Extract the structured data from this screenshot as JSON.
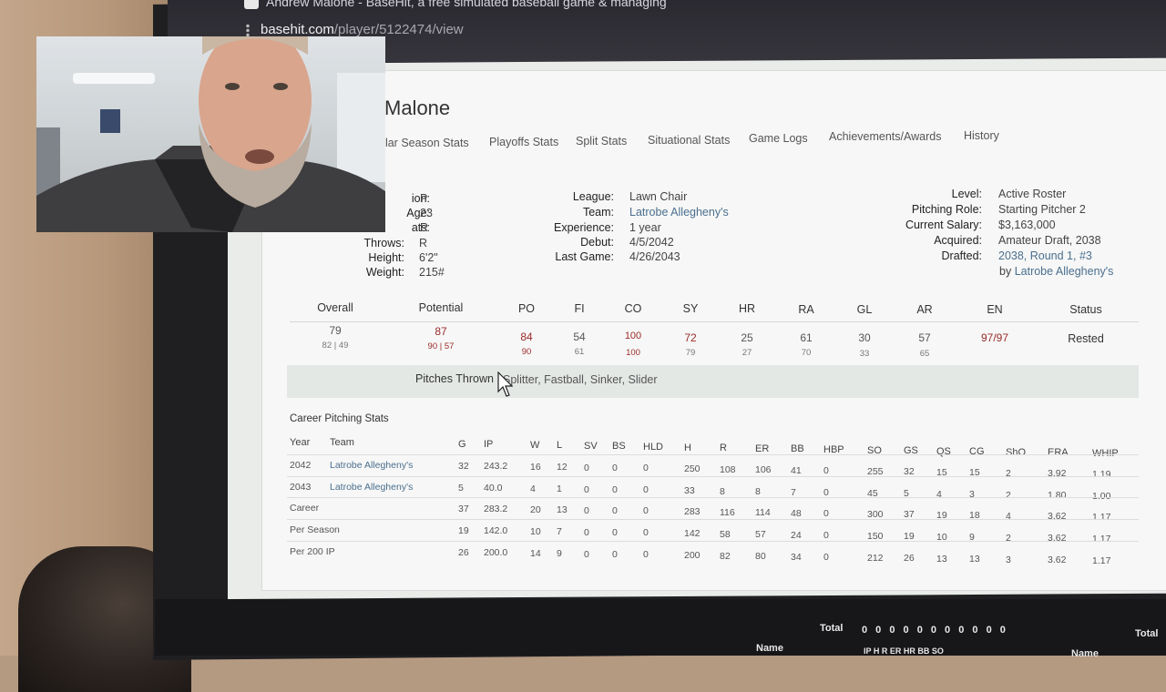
{
  "browser": {
    "tab_title": "Andrew Malone - BaseHit, a free simulated baseball game & managing",
    "url_host": "basehit.com",
    "url_path": "/player/5122474/view"
  },
  "player": {
    "name": "Malone"
  },
  "tabs": [
    "ular Season Stats",
    "Playoffs Stats",
    "Split Stats",
    "Situational Stats",
    "Game Logs",
    "Achievements/Awards",
    "History"
  ],
  "bio_left": [
    {
      "label": "ion:",
      "value": "P"
    },
    {
      "label": "Age:",
      "value": "23"
    },
    {
      "label": "ats:",
      "value": "R"
    },
    {
      "label": "Throws:",
      "value": "R"
    },
    {
      "label": "Height:",
      "value": "6'2\""
    },
    {
      "label": "Weight:",
      "value": "215#"
    }
  ],
  "bio_mid": [
    {
      "label": "League:",
      "value": "Lawn Chair"
    },
    {
      "label": "Team:",
      "value": "Latrobe Allegheny's"
    },
    {
      "label": "Experience:",
      "value": "1 year"
    },
    {
      "label": "Debut:",
      "value": "4/5/2042"
    },
    {
      "label": "Last Game:",
      "value": "4/26/2043"
    }
  ],
  "bio_right": [
    {
      "label": "Level:",
      "value": "Active Roster"
    },
    {
      "label": "Pitching Role:",
      "value": "Starting Pitcher 2"
    },
    {
      "label": "Current Salary:",
      "value": "$3,163,000"
    },
    {
      "label": "Acquired:",
      "value": "Amateur Draft, 2038"
    },
    {
      "label": "Drafted:",
      "value": "2038, Round 1, #3"
    }
  ],
  "drafted_by_prefix": "by",
  "drafted_by_team": "Latrobe Allegheny's",
  "ratings": {
    "headers": [
      "Overall",
      "Potential",
      "PO",
      "FI",
      "CO",
      "SY",
      "HR",
      "RA",
      "GL",
      "AR",
      "EN",
      "Status"
    ],
    "current": [
      "79",
      "87",
      "84",
      "54",
      "100",
      "72",
      "25",
      "61",
      "30",
      "57",
      "97/97",
      "Rested"
    ],
    "sub": [
      "82 | 49",
      "90 | 57",
      "90",
      "61",
      "100",
      "79",
      "27",
      "70",
      "33",
      "65",
      "",
      ""
    ]
  },
  "pitches": {
    "label": "Pitches Thrown",
    "value": "Splitter, Fastball, Sinker, Slider"
  },
  "career": {
    "title": "Career Pitching Stats",
    "columns": [
      "Year",
      "Team",
      "G",
      "IP",
      "W",
      "L",
      "SV",
      "BS",
      "HLD",
      "H",
      "R",
      "ER",
      "BB",
      "HBP",
      "SO",
      "GS",
      "QS",
      "CG",
      "ShO",
      "ERA",
      "WHIP"
    ],
    "rows": [
      [
        "2042",
        "Latrobe Allegheny's",
        "32",
        "243.2",
        "16",
        "12",
        "0",
        "0",
        "0",
        "250",
        "108",
        "106",
        "41",
        "0",
        "255",
        "32",
        "15",
        "15",
        "2",
        "3.92",
        "1.19"
      ],
      [
        "2043",
        "Latrobe Allegheny's",
        "5",
        "40.0",
        "4",
        "1",
        "0",
        "0",
        "0",
        "33",
        "8",
        "8",
        "7",
        "0",
        "45",
        "5",
        "4",
        "3",
        "2",
        "1.80",
        "1.00"
      ],
      [
        "Career",
        "",
        "37",
        "283.2",
        "20",
        "13",
        "0",
        "0",
        "0",
        "283",
        "116",
        "114",
        "48",
        "0",
        "300",
        "37",
        "19",
        "18",
        "4",
        "3.62",
        "1.17"
      ],
      [
        "Per Season",
        "",
        "19",
        "142.0",
        "10",
        "7",
        "0",
        "0",
        "0",
        "142",
        "58",
        "57",
        "24",
        "0",
        "150",
        "19",
        "10",
        "9",
        "2",
        "3.62",
        "1.17"
      ],
      [
        "Per 200 IP",
        "",
        "26",
        "200.0",
        "14",
        "9",
        "0",
        "0",
        "0",
        "200",
        "82",
        "80",
        "34",
        "0",
        "212",
        "26",
        "13",
        "13",
        "3",
        "3.62",
        "1.17"
      ]
    ]
  },
  "bottom": {
    "total_label": "Total",
    "zeros": "0 0 0 0 0 0 0 0 0 0 0",
    "name_label": "Name",
    "cols_label": "IP  H  R  ER HR BB SO",
    "total_right": "Total",
    "name_right": "Name"
  }
}
